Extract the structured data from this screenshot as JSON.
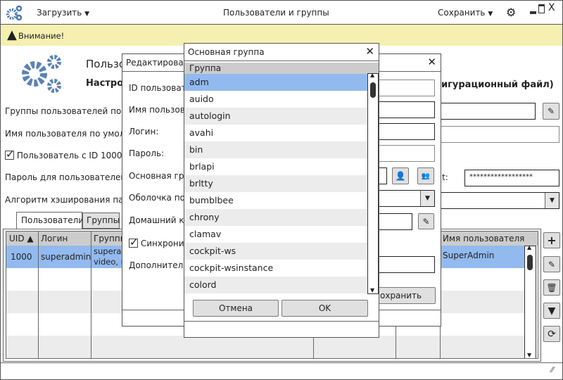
{
  "titlebar": {
    "load": "Загрузить",
    "title": "Пользователи и группы",
    "save": "Сохранить"
  },
  "warning": {
    "text": "Внимание!"
  },
  "header": {
    "title": "Пользо",
    "subtitle": "Настрой",
    "subtitle_tail": "игурационный файл)"
  },
  "settings": {
    "default_groups": "Группы пользователей по ум",
    "default_username": "Имя пользователя по умолча",
    "user1000": "Пользователь с ID 1000 :",
    "password_label": "Пароль для пользователей п",
    "root_tail": "t:",
    "root_password": "******************",
    "hash_label": "Алгоритм хэширования парол"
  },
  "tabs": [
    "Пользователи",
    "Группы"
  ],
  "table": {
    "columns": [
      "UID ▲",
      "Логин",
      "Группы",
      "",
      "",
      "Имя пользователя"
    ],
    "rows": [
      {
        "uid": "1000",
        "login": "superadmin",
        "groups1": "superad",
        "groups2": "video, u",
        "name": "SuperAdmin"
      }
    ]
  },
  "edit_dialog": {
    "title": "Редактироват",
    "labels": [
      "ID пользовате",
      "Имя пользова",
      "Логин:",
      "Пароль:",
      "Основная груп",
      "Оболочка пол",
      "Домашний ка",
      "Синхрониз",
      "Дополнительн"
    ],
    "save": "охранить"
  },
  "group_dialog": {
    "title": "Основная группа",
    "header": "Группа",
    "items": [
      "adm",
      "auido",
      "autologin",
      "avahi",
      "bin",
      "brlapi",
      "brltty",
      "bumblbee",
      "chrony",
      "clamav",
      "cockpit-ws",
      "cockpit-wsinstance",
      "colord"
    ],
    "selected": "adm",
    "cancel": "Отмена",
    "ok": "OK"
  },
  "colors": {
    "accent": "#4a78b0",
    "selection": "#92baef",
    "warning_bg": "#f5f0b0",
    "header_bg": "#cccccc",
    "alt_row": "#ececec"
  }
}
